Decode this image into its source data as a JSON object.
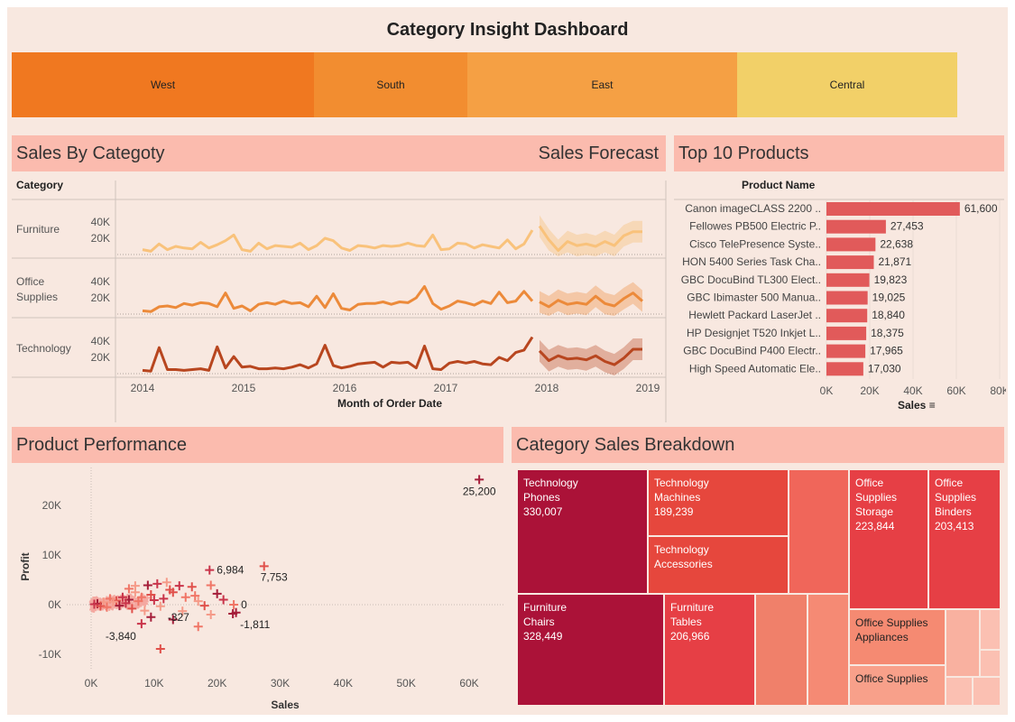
{
  "title": "Category Insight Dashboard",
  "regions": [
    {
      "name": "West",
      "color": "#f07820"
    },
    {
      "name": "South",
      "color": "#f28d30"
    },
    {
      "name": "East",
      "color": "#f5a044"
    },
    {
      "name": "Central",
      "color": "#f2d068"
    }
  ],
  "sales_by_category": {
    "title": "Sales By Categoty",
    "forecast_title": "Sales Forecast",
    "category_header": "Category",
    "rows": [
      {
        "name": "Furniture",
        "color": "#f9c27b",
        "band": "#f6b96b"
      },
      {
        "name": "Office\nSupplies",
        "color": "#ec8a3a",
        "band": "#ef8a3a"
      },
      {
        "name": "Technology",
        "color": "#b8461f",
        "band": "#b8461f"
      }
    ],
    "y_ticks": [
      "40K",
      "20K"
    ],
    "x_ticks": [
      "2014",
      "2015",
      "2016",
      "2017",
      "2018",
      "2019"
    ],
    "x_label": "Month of Order Date"
  },
  "top_products": {
    "title": "Top 10 Products",
    "header": "Product Name",
    "x_ticks": [
      "0K",
      "20K",
      "40K",
      "60K",
      "80K"
    ],
    "x_label": "Sales"
  },
  "product_performance": {
    "title": "Product Performance",
    "y_label": "Profit",
    "x_label": "Sales",
    "y_ticks": [
      "20K",
      "10K",
      "0K",
      "-10K"
    ],
    "x_ticks": [
      "0K",
      "10K",
      "20K",
      "30K",
      "40K",
      "50K",
      "60K"
    ],
    "annotations": [
      "25,200",
      "6,984",
      "7,753",
      "0",
      "-327",
      "-1,811",
      "-3,840"
    ]
  },
  "breakdown": {
    "title": "Category Sales Breakdown",
    "tiles": [
      {
        "label": "Technology\nPhones\n330,007",
        "color": "#ab1238"
      },
      {
        "label": "Technology\nMachines\n189,239",
        "color": "#e6473d"
      },
      {
        "label": "Technology\nAccessories",
        "color": "#e6473d"
      },
      {
        "label": "",
        "color": "#f0665a"
      },
      {
        "label": "Office\nSupplies\nStorage\n223,844",
        "color": "#e63f45"
      },
      {
        "label": "Office\nSupplies\nBinders\n203,413",
        "color": "#e63f45"
      },
      {
        "label": "Furniture\nChairs\n328,449",
        "color": "#ab1238"
      },
      {
        "label": "Furniture\nTables\n206,966",
        "color": "#e63f45"
      },
      {
        "label": "",
        "color": "#f0806a"
      },
      {
        "label": "",
        "color": "#f58a74"
      },
      {
        "label": "Office Supplies\nAppliances",
        "color": "#f58a72"
      },
      {
        "label": "Office Supplies",
        "color": "#f8a08a"
      },
      {
        "label": "",
        "color": "#f9b1a0"
      },
      {
        "label": "",
        "color": "#fbc0b2"
      },
      {
        "label": "",
        "color": "#fbc0b2"
      },
      {
        "label": "",
        "color": "#fbc0b2"
      },
      {
        "label": "",
        "color": "#fbc0b2"
      }
    ]
  },
  "chart_data": [
    {
      "type": "line",
      "title": "Sales By Categoty",
      "xlabel": "Month of Order Date",
      "ylabel": "",
      "x_range": [
        "2014",
        "2019"
      ],
      "series": [
        {
          "name": "Furniture",
          "values": [
            6000,
            4000,
            13000,
            6000,
            10000,
            8000,
            7000,
            15000,
            8000,
            12000,
            17000,
            24000,
            6000,
            4000,
            14000,
            7000,
            11000,
            10000,
            9000,
            14000,
            6000,
            11000,
            20000,
            17000,
            8000,
            5000,
            11000,
            10000,
            8000,
            11000,
            10000,
            11000,
            14000,
            11000,
            10000,
            24000,
            6000,
            7000,
            14000,
            13000,
            8000,
            12000,
            10000,
            8000,
            18000,
            7000,
            13000,
            30000
          ]
        },
        {
          "name": "Office Supplies",
          "values": [
            4000,
            3000,
            9000,
            10000,
            8000,
            13000,
            11000,
            14000,
            13000,
            9000,
            26000,
            7000,
            10000,
            4000,
            12000,
            14000,
            12000,
            16000,
            13000,
            14000,
            9000,
            22000,
            8000,
            25000,
            7000,
            5000,
            12000,
            13000,
            13000,
            15000,
            12000,
            15000,
            14000,
            20000,
            34000,
            13000,
            6000,
            10000,
            16000,
            14000,
            11000,
            16000,
            13000,
            27000,
            14000,
            16000,
            28000,
            16000
          ]
        },
        {
          "name": "Technology",
          "values": [
            4000,
            3000,
            32000,
            5000,
            5000,
            4000,
            5000,
            6000,
            4000,
            33000,
            7000,
            21000,
            8000,
            9000,
            6000,
            6000,
            7000,
            6000,
            8000,
            11000,
            7000,
            12000,
            35000,
            10000,
            7000,
            9000,
            12000,
            13000,
            14000,
            8000,
            14000,
            13000,
            14000,
            7000,
            34000,
            6000,
            5000,
            13000,
            15000,
            13000,
            15000,
            12000,
            11000,
            20000,
            16000,
            26000,
            29000,
            45000
          ]
        }
      ],
      "forecast": [
        {
          "name": "Furniture",
          "values": [
            35000,
            18000,
            5000,
            16000,
            11000,
            13000,
            10000,
            16000,
            11000,
            23000,
            28000,
            28000
          ]
        },
        {
          "name": "Office Supplies",
          "values": [
            15000,
            9000,
            17000,
            12000,
            14000,
            12000,
            22000,
            13000,
            10000,
            19000,
            26000,
            16000
          ]
        },
        {
          "name": "Technology",
          "values": [
            28000,
            16000,
            22000,
            18000,
            19000,
            17000,
            22000,
            15000,
            11000,
            19000,
            30000,
            30000
          ]
        }
      ]
    },
    {
      "type": "bar",
      "title": "Top 10 Products",
      "xlabel": "Sales",
      "ylabel": "Product Name",
      "xlim": [
        0,
        80000
      ],
      "categories": [
        "Canon imageCLASS 2200 ..",
        "Fellowes PB500 Electric P..",
        "Cisco TelePresence Syste..",
        "HON 5400 Series Task Cha..",
        "GBC DocuBind TL300 Elect..",
        "GBC Ibimaster 500 Manua..",
        "Hewlett Packard LaserJet ..",
        "HP Designjet T520 Inkjet L..",
        "GBC DocuBind P400 Electr..",
        "High Speed Automatic Ele.."
      ],
      "values": [
        61600,
        27453,
        22638,
        21871,
        19823,
        19025,
        18840,
        18375,
        17965,
        17030
      ],
      "value_labels": [
        "61,600",
        "27,453",
        "22,638",
        "21,871",
        "19,823",
        "19,025",
        "18,840",
        "18,375",
        "17,965",
        "17,030"
      ]
    },
    {
      "type": "scatter",
      "title": "Product Performance",
      "xlabel": "Sales",
      "ylabel": "Profit",
      "xlim": [
        -2000,
        65000
      ],
      "ylim": [
        -12000,
        27000
      ],
      "points": [
        [
          61600,
          25200
        ],
        [
          18800,
          6984
        ],
        [
          27453,
          7753
        ],
        [
          22638,
          0
        ],
        [
          11000,
          -327
        ],
        [
          22500,
          -1811
        ],
        [
          8000,
          -3840
        ],
        [
          11000,
          -8900
        ],
        [
          17000,
          -4400
        ],
        [
          19000,
          -2000
        ],
        [
          23000,
          -1600
        ],
        [
          14000,
          3800
        ],
        [
          16000,
          3600
        ],
        [
          19000,
          3900
        ],
        [
          12000,
          4500
        ],
        [
          9000,
          3900
        ],
        [
          10500,
          4200
        ],
        [
          13000,
          2500
        ],
        [
          15000,
          1500
        ],
        [
          17000,
          700
        ],
        [
          20000,
          2200
        ],
        [
          21000,
          1000
        ],
        [
          18000,
          -200
        ],
        [
          16500,
          1800
        ],
        [
          14500,
          -1300
        ],
        [
          13000,
          -3000
        ],
        [
          11500,
          1200
        ],
        [
          9500,
          2000
        ],
        [
          8000,
          1500
        ],
        [
          7000,
          2500
        ],
        [
          6000,
          1000
        ],
        [
          5000,
          1500
        ],
        [
          4000,
          800
        ],
        [
          3000,
          1200
        ],
        [
          2000,
          500
        ],
        [
          1000,
          200
        ],
        [
          500,
          100
        ],
        [
          1500,
          -300
        ],
        [
          2500,
          -500
        ],
        [
          3500,
          600
        ],
        [
          4500,
          -200
        ],
        [
          5500,
          300
        ],
        [
          6500,
          -800
        ],
        [
          7500,
          700
        ],
        [
          8500,
          -1200
        ],
        [
          9500,
          -2500
        ],
        [
          10000,
          900
        ],
        [
          12500,
          3000
        ],
        [
          6000,
          3200
        ],
        [
          7000,
          3800
        ]
      ]
    },
    {
      "type": "table",
      "title": "Category Sales Breakdown",
      "categories": [
        "Technology Phones",
        "Furniture Chairs",
        "Office Supplies Storage",
        "Furniture Tables",
        "Office Supplies Binders",
        "Technology Machines"
      ],
      "values": [
        330007,
        328449,
        223844,
        206966,
        203413,
        189239
      ]
    }
  ]
}
